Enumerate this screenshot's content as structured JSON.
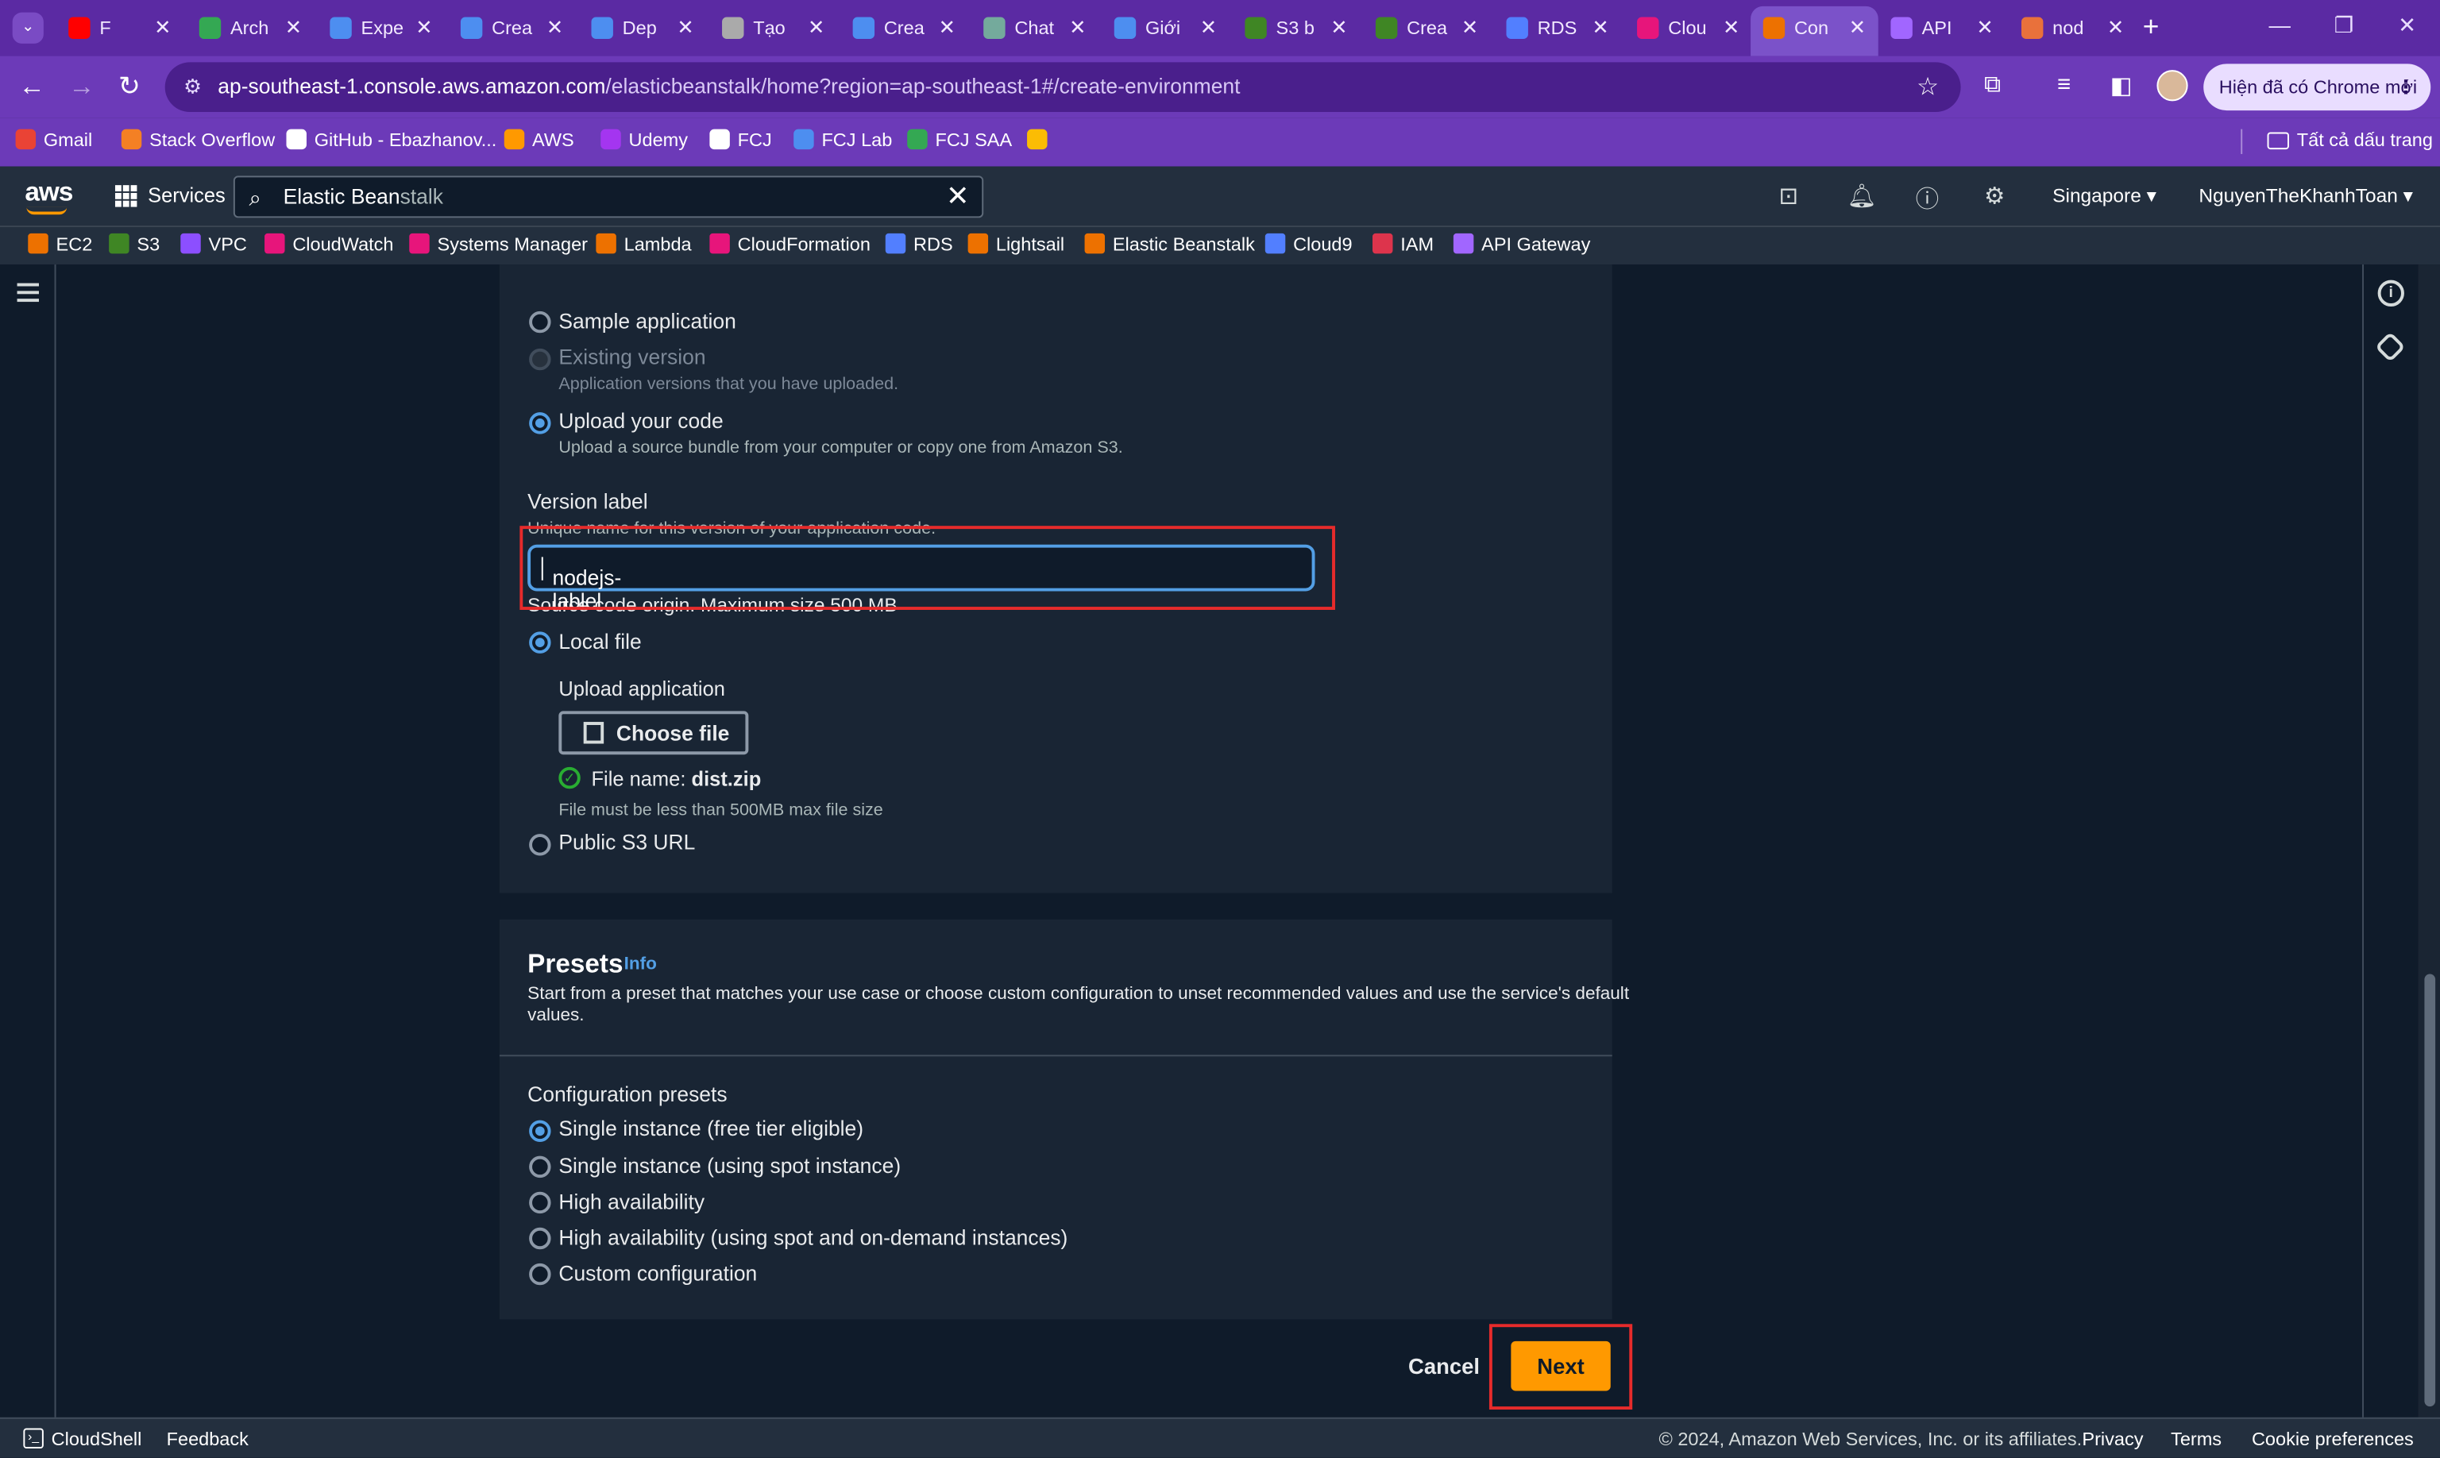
{
  "browser": {
    "tabs": [
      {
        "label": "F",
        "color": "#ff0000"
      },
      {
        "label": "Arch",
        "color": "#34a853"
      },
      {
        "label": "Expe",
        "color": "#4d8ef0"
      },
      {
        "label": "Crea",
        "color": "#4d8ef0"
      },
      {
        "label": "Dep",
        "color": "#4d8ef0"
      },
      {
        "label": "Tạo",
        "color": "#aaaaaa"
      },
      {
        "label": "Crea",
        "color": "#4d8ef0"
      },
      {
        "label": "Chat",
        "color": "#74aa9c"
      },
      {
        "label": "Giới",
        "color": "#4d8ef0"
      },
      {
        "label": "S3 b",
        "color": "#3f8624"
      },
      {
        "label": "Crea",
        "color": "#3f8624"
      },
      {
        "label": "RDS",
        "color": "#527fff"
      },
      {
        "label": "Clou",
        "color": "#e7157b"
      },
      {
        "label": "Con",
        "color": "#ed7100"
      },
      {
        "label": "API",
        "color": "#a166ff"
      },
      {
        "label": "nod",
        "color": "#e9713b"
      }
    ],
    "url_host": "ap-southeast-1.console.aws.amazon.com",
    "url_path": "/elasticbeanstalk/home?region=ap-southeast-1#/create-environment",
    "update_label": "Hiện đã có Chrome mới",
    "bookmarks": [
      {
        "label": "Gmail",
        "color": "#ea4335"
      },
      {
        "label": "Stack Overflow",
        "color": "#f48024"
      },
      {
        "label": "GitHub - Ebazhanov...",
        "color": "#ffffff"
      },
      {
        "label": "AWS",
        "color": "#ff9900"
      },
      {
        "label": "Udemy",
        "color": "#a435f0"
      },
      {
        "label": "FCJ",
        "color": "#ffffff"
      },
      {
        "label": "FCJ Lab",
        "color": "#4d8ef0"
      },
      {
        "label": "FCJ SAA",
        "color": "#34a853"
      },
      {
        "label": "",
        "color": "#fbbc04"
      }
    ],
    "all_bookmarks_label": "Tất cả dấu trang"
  },
  "aws_header": {
    "logo": "aws",
    "services_label": "Services",
    "search_typed": "Elastic Bean",
    "search_hint": "stalk",
    "region": "Singapore",
    "user": "NguyenTheKhanhToan"
  },
  "favorites": [
    {
      "label": "EC2",
      "color": "#ed7100"
    },
    {
      "label": "S3",
      "color": "#3f8624"
    },
    {
      "label": "VPC",
      "color": "#8c4fff"
    },
    {
      "label": "CloudWatch",
      "color": "#e7157b"
    },
    {
      "label": "Systems Manager",
      "color": "#e7157b"
    },
    {
      "label": "Lambda",
      "color": "#ed7100"
    },
    {
      "label": "CloudFormation",
      "color": "#e7157b"
    },
    {
      "label": "RDS",
      "color": "#527fff"
    },
    {
      "label": "Lightsail",
      "color": "#ed7100"
    },
    {
      "label": "Elastic Beanstalk",
      "color": "#ed7100"
    },
    {
      "label": "Cloud9",
      "color": "#527fff"
    },
    {
      "label": "IAM",
      "color": "#dd344c"
    },
    {
      "label": "API Gateway",
      "color": "#a166ff"
    }
  ],
  "application_code": {
    "options": [
      {
        "label": "Sample application",
        "selected": false,
        "disabled": false
      },
      {
        "label": "Existing version",
        "selected": false,
        "disabled": true,
        "description": "Application versions that you have uploaded."
      },
      {
        "label": "Upload your code",
        "selected": true,
        "disabled": false,
        "description": "Upload a source bundle from your computer or copy one from Amazon S3."
      }
    ],
    "version_label": {
      "label": "Version label",
      "description": "Unique name for this version of your application code.",
      "value": "nodejs-lablel"
    },
    "source_origin_label": "Source code origin. Maximum size 500 MB",
    "local_file_label": "Local file",
    "upload_application_label": "Upload application",
    "choose_file_label": "Choose file",
    "file_name_prefix": "File name:",
    "file_name": "dist.zip",
    "file_hint": "File must be less than 500MB max file size",
    "public_s3_label": "Public S3 URL"
  },
  "presets": {
    "title": "Presets",
    "info_label": "Info",
    "description_line1": "Start from a preset that matches your use case or choose custom configuration to unset recommended values and use the service's default",
    "description_line2": "values.",
    "group_label": "Configuration presets",
    "options": [
      {
        "label": "Single instance (free tier eligible)",
        "selected": true
      },
      {
        "label": "Single instance (using spot instance)",
        "selected": false
      },
      {
        "label": "High availability",
        "selected": false
      },
      {
        "label": "High availability (using spot and on-demand instances)",
        "selected": false
      },
      {
        "label": "Custom configuration",
        "selected": false
      }
    ]
  },
  "actions": {
    "cancel_label": "Cancel",
    "next_label": "Next"
  },
  "footer": {
    "cloudshell_label": "CloudShell",
    "feedback_label": "Feedback",
    "copyright": "© 2024, Amazon Web Services, Inc. or its affiliates.",
    "privacy_label": "Privacy",
    "terms_label": "Terms",
    "cookie_label": "Cookie preferences"
  },
  "colors": {
    "accent_orange": "#ff9900",
    "selected_blue": "#539fe5",
    "highlight_red": "#e62b2b",
    "success_green": "#29ad32"
  }
}
